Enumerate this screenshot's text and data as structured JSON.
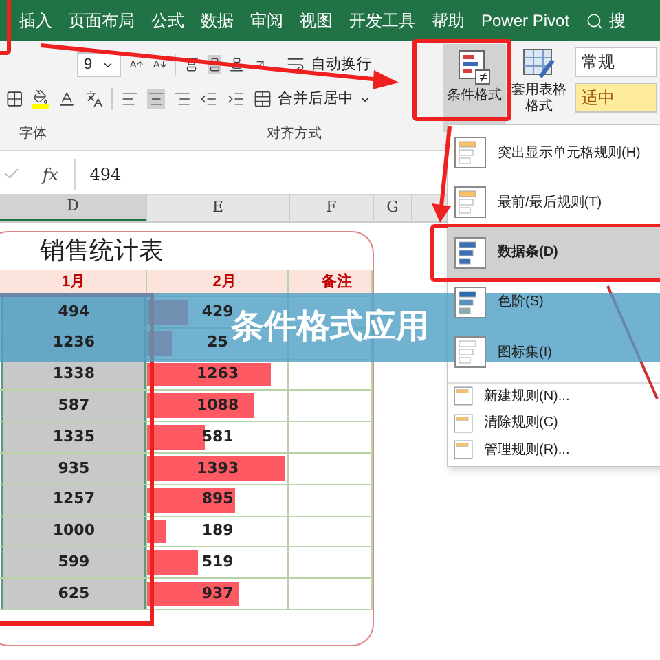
{
  "ribbon_tabs": [
    {
      "label": "插入",
      "selected": false
    },
    {
      "label": "页面布局",
      "selected": false
    },
    {
      "label": "公式",
      "selected": false
    },
    {
      "label": "数据",
      "selected": false
    },
    {
      "label": "审阅",
      "selected": false
    },
    {
      "label": "视图",
      "selected": false
    },
    {
      "label": "开发工具",
      "selected": false
    },
    {
      "label": "帮助",
      "selected": false
    },
    {
      "label": "Power Pivot",
      "selected": false
    }
  ],
  "search": {
    "label": "搜"
  },
  "ribbon": {
    "font_size": "9",
    "wrap_text": "自动换行",
    "merge_center": "合并后居中",
    "font_group": "字体",
    "align_group": "对齐方式",
    "conditional_format": {
      "label": "条件格式",
      "selected": true
    },
    "table_format": "套用表格格式",
    "styles": [
      {
        "label": "常规",
        "kind": "normal"
      },
      {
        "label": "适中",
        "kind": "neutral"
      }
    ]
  },
  "formula_bar": {
    "fx": "fx",
    "value": "494"
  },
  "columns": [
    {
      "label": "D",
      "selected": true
    },
    {
      "label": "E",
      "selected": false
    },
    {
      "label": "F",
      "selected": false
    },
    {
      "label": "G",
      "selected": false
    }
  ],
  "sheet": {
    "title": "销售统计表",
    "headers": [
      "1月",
      "2月",
      "备注"
    ],
    "rows": [
      {
        "jan": "494",
        "feb": "429",
        "level": 0.3
      },
      {
        "jan": "1236",
        "feb": "25",
        "level": 0.18
      },
      {
        "jan": "1338",
        "feb": "1263",
        "level": 0.9
      },
      {
        "jan": "587",
        "feb": "1088",
        "level": 0.78
      },
      {
        "jan": "1335",
        "feb": "581",
        "level": 0.42
      },
      {
        "jan": "935",
        "feb": "1393",
        "level": 1.0
      },
      {
        "jan": "1257",
        "feb": "895",
        "level": 0.64
      },
      {
        "jan": "1000",
        "feb": "189",
        "level": 0.14
      },
      {
        "jan": "599",
        "feb": "519",
        "level": 0.37
      },
      {
        "jan": "625",
        "feb": "937",
        "level": 0.67
      }
    ]
  },
  "menu": [
    {
      "label": "突出显示单元格规则(H)",
      "kind": "main",
      "selected": false
    },
    {
      "label": "最前/最后规则(T)",
      "kind": "main",
      "selected": false
    },
    {
      "label": "数据条(D)",
      "kind": "main",
      "selected": true
    },
    {
      "label": "色阶(S)",
      "kind": "main",
      "selected": false
    },
    {
      "label": "图标集(I)",
      "kind": "main",
      "selected": false
    },
    {
      "label": "新建规则(N)...",
      "kind": "small"
    },
    {
      "label": "清除规则(C)",
      "kind": "small"
    },
    {
      "label": "管理规则(R)...",
      "kind": "small"
    }
  ],
  "banner": "条件格式应用"
}
